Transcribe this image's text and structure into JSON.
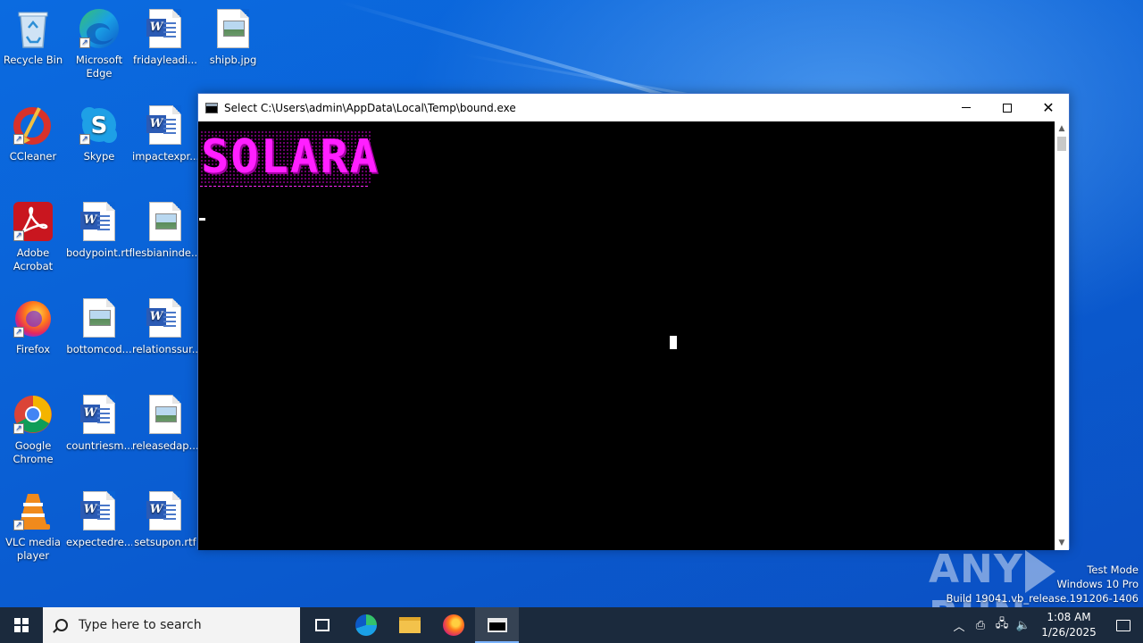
{
  "desktop": {
    "icons": [
      {
        "label": "Recycle Bin",
        "label2": "",
        "icon": "recycle-bin-icon"
      },
      {
        "label": "Microsoft",
        "label2": "Edge",
        "icon": "edge-icon"
      },
      {
        "label": "fridayleadi...",
        "label2": "",
        "icon": "word-doc-icon"
      },
      {
        "label": "shipb.jpg",
        "label2": "",
        "icon": "image-file-icon"
      },
      {
        "label": "CCleaner",
        "label2": "",
        "icon": "ccleaner-icon"
      },
      {
        "label": "Skype",
        "label2": "",
        "icon": "skype-icon"
      },
      {
        "label": "impactexpr...",
        "label2": "",
        "icon": "word-doc-icon"
      },
      {
        "label": "Adobe",
        "label2": "Acrobat",
        "icon": "acrobat-icon"
      },
      {
        "label": "bodypoint.rtf",
        "label2": "",
        "icon": "word-doc-icon"
      },
      {
        "label": "lesbianinde...",
        "label2": "",
        "icon": "image-file-icon"
      },
      {
        "label": "Firefox",
        "label2": "",
        "icon": "firefox-icon"
      },
      {
        "label": "bottomcod...",
        "label2": "",
        "icon": "image-file-icon"
      },
      {
        "label": "relationssur...",
        "label2": "",
        "icon": "word-doc-icon"
      },
      {
        "label": "Google",
        "label2": "Chrome",
        "icon": "chrome-icon"
      },
      {
        "label": "countriesm...",
        "label2": "",
        "icon": "word-doc-icon"
      },
      {
        "label": "releasedap...",
        "label2": "",
        "icon": "image-file-icon"
      },
      {
        "label": "VLC media",
        "label2": "player",
        "icon": "vlc-icon"
      },
      {
        "label": "expectedre...",
        "label2": "",
        "icon": "word-doc-icon"
      },
      {
        "label": "setsupon.rtf",
        "label2": "",
        "icon": "word-doc-icon"
      }
    ]
  },
  "window": {
    "title": "Select C:\\Users\\admin\\AppData\\Local\\Temp\\bound.exe",
    "minimize": "minimize",
    "maximize": "maximize",
    "close": "✕"
  },
  "console": {
    "banner": "SOLARA"
  },
  "watermark": {
    "left": "ANY",
    "right": "RUN"
  },
  "sysinfo": {
    "line1": "Test Mode",
    "line2": "Windows 10 Pro",
    "line3": "Build 19041.vb_release.191206-1406"
  },
  "taskbar": {
    "search_placeholder": "Type here to search",
    "time": "1:08 AM",
    "date": "1/26/2025"
  },
  "colors": {
    "desktop": "#0a63d6",
    "taskbar": "#1b2a3d",
    "banner": "#ff1fff"
  }
}
